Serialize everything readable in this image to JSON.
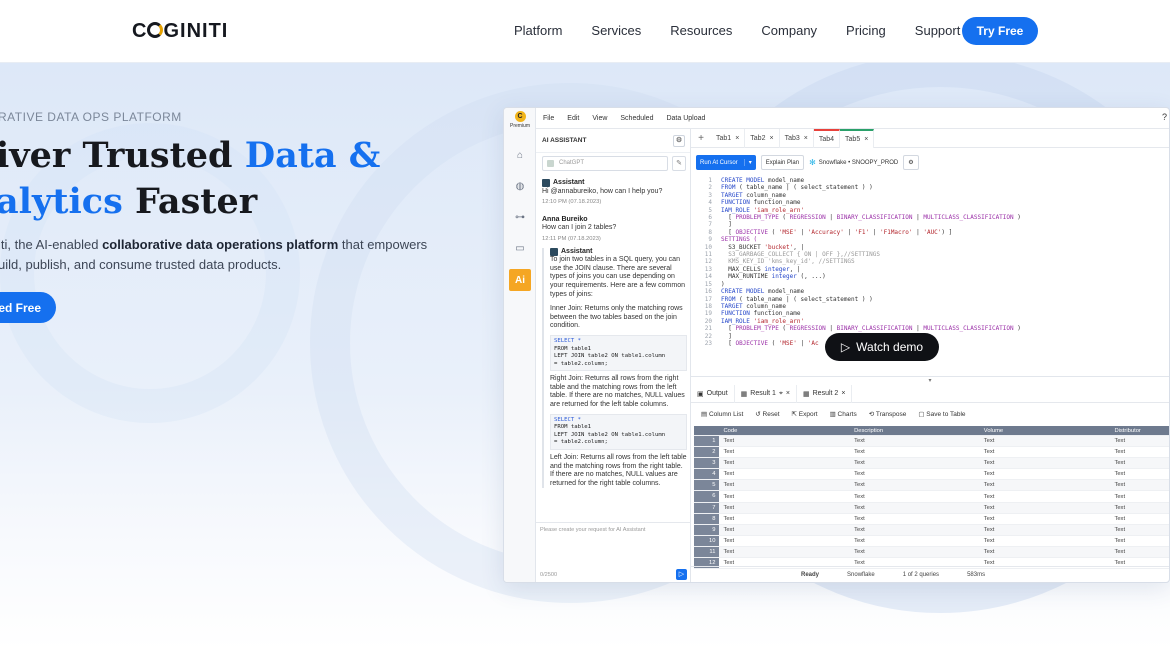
{
  "nav": {
    "logo": "COGINITI",
    "items": [
      "Platform",
      "Services",
      "Resources",
      "Company",
      "Pricing",
      "Support"
    ],
    "cta": "Try Free"
  },
  "hero": {
    "eyebrow": "RATIVE DATA OPS PLATFORM",
    "title_line1_a": "iver Trusted ",
    "title_line1_b": "Data &",
    "title_line2_a": "alytics",
    "title_line2_b": " Faster",
    "sub_a": "iti, the AI-enabled ",
    "sub_b": "collaborative data operations platform",
    "sub_c": " that empowers",
    "sub_line2": "uild, publish, and consume trusted data products.",
    "cta": "ed Free",
    "watch_demo": "Watch demo"
  },
  "app": {
    "premium": "Premium",
    "menubar": [
      "File",
      "Edit",
      "View",
      "Scheduled",
      "Data Upload"
    ],
    "help": "?",
    "ai": {
      "header": "AI ASSISTANT",
      "model": "ChatGPT",
      "assistant_name": "Assistant",
      "greeting": "Hi @annabureiko, how can I help you?",
      "ts1": "12:10 PM (07.18.2023)",
      "user_name": "Anna Bureiko",
      "question": "How can I join 2 tables?",
      "ts2": "12:11 PM (07.18.2023)",
      "answer_intro": "To join two tables in a SQL query, you can use the JOIN clause. There are several types of joins you can use depending on your requirements. Here are a few common types of joins:",
      "inner": "Inner Join: Returns only the matching rows between the two tables based on the join condition.",
      "code1_l1": "SELECT *",
      "code1_l2": "FROM table1",
      "code1_l3": "LEFT JOIN table2 ON table1.column",
      "code1_l4": "= table2.column;",
      "right": "Right Join: Returns all rows from the right table and the matching rows from the left table. If there are no matches, NULL values are returned for the left table columns.",
      "code2_l1": "SELECT *",
      "code2_l2": "FROM table1",
      "code2_l3": "LEFT JOIN table2 ON table1.column",
      "code2_l4": "= table2.column;",
      "left": "Left Join: Returns all rows from the left table and the matching rows from the right table. If there are no matches, NULL values are returned for the right table columns.",
      "placeholder": "Please create your request for AI Assistant",
      "counter": "0/2500"
    },
    "tabs": [
      "Tab1",
      "Tab2",
      "Tab3",
      "Tab4",
      "Tab5"
    ],
    "toolbar": {
      "run": "Run At Cursor",
      "explain": "Explain Plan",
      "connection": "Snowflake • SNOOPY_PROD"
    },
    "code_lines": [
      [
        {
          "t": "CREATE MODEL ",
          "c": "kw"
        },
        {
          "t": "model_name",
          "c": ""
        }
      ],
      [
        {
          "t": "FROM ",
          "c": "kw"
        },
        {
          "t": "( table_name | ( select_statement ) )",
          "c": ""
        }
      ],
      [
        {
          "t": "TARGET ",
          "c": "kw"
        },
        {
          "t": "column_name",
          "c": ""
        }
      ],
      [
        {
          "t": "FUNCTION ",
          "c": "kw"
        },
        {
          "t": "function_name",
          "c": ""
        }
      ],
      [
        {
          "t": "IAM_ROLE ",
          "c": "kw"
        },
        {
          "t": "'iam_role_arn'",
          "c": "st"
        }
      ],
      [
        {
          "t": "  [ ",
          "c": ""
        },
        {
          "t": "PROBLEM_TYPE",
          "c": "fn"
        },
        {
          "t": " ( ",
          "c": ""
        },
        {
          "t": "REGRESSION",
          "c": "fn"
        },
        {
          "t": " | ",
          "c": ""
        },
        {
          "t": "BINARY_CLASSIFICATION",
          "c": "fn"
        },
        {
          "t": " | ",
          "c": ""
        },
        {
          "t": "MULTICLASS_CLASSIFICATION",
          "c": "fn"
        },
        {
          "t": " )",
          "c": ""
        }
      ],
      [
        {
          "t": "  ]",
          "c": ""
        }
      ],
      [
        {
          "t": "  [ ",
          "c": ""
        },
        {
          "t": "OBJECTIVE",
          "c": "fn"
        },
        {
          "t": " ( ",
          "c": ""
        },
        {
          "t": "'MSE'",
          "c": "st"
        },
        {
          "t": " | ",
          "c": ""
        },
        {
          "t": "'Accuracy'",
          "c": "st"
        },
        {
          "t": " | ",
          "c": ""
        },
        {
          "t": "'F1'",
          "c": "st"
        },
        {
          "t": " | ",
          "c": ""
        },
        {
          "t": "'F1Macro'",
          "c": "st"
        },
        {
          "t": " | ",
          "c": ""
        },
        {
          "t": "'AUC'",
          "c": "st"
        },
        {
          "t": ") ]",
          "c": ""
        }
      ],
      [
        {
          "t": "SETTINGS (",
          "c": "fn"
        }
      ],
      [
        {
          "t": "  S3_BUCKET ",
          "c": ""
        },
        {
          "t": "'bucket'",
          "c": "st"
        },
        {
          "t": ", |",
          "c": ""
        }
      ],
      [
        {
          "t": "  S3_GARBAGE_COLLECT { ON | OFF },//SETTINGS",
          "c": "cm"
        }
      ],
      [
        {
          "t": "  KMS_KEY_ID 'kms_key_id', //SETTINGS",
          "c": "cm"
        }
      ],
      [
        {
          "t": "  MAX_CELLS ",
          "c": ""
        },
        {
          "t": "integer",
          "c": "kw"
        },
        {
          "t": ", |",
          "c": ""
        }
      ],
      [
        {
          "t": "  MAX_RUNTIME ",
          "c": ""
        },
        {
          "t": "integer",
          "c": "kw"
        },
        {
          "t": " (, ...)",
          "c": ""
        }
      ],
      [
        {
          "t": ")",
          "c": ""
        }
      ],
      [
        {
          "t": "CREATE MODEL ",
          "c": "kw"
        },
        {
          "t": "model_name",
          "c": ""
        }
      ],
      [
        {
          "t": "FROM ",
          "c": "kw"
        },
        {
          "t": "( table_name | ( select_statement ) )",
          "c": ""
        }
      ],
      [
        {
          "t": "TARGET ",
          "c": "kw"
        },
        {
          "t": "column_name",
          "c": ""
        }
      ],
      [
        {
          "t": "FUNCTION ",
          "c": "kw"
        },
        {
          "t": "function_name",
          "c": ""
        }
      ],
      [
        {
          "t": "IAM_ROLE ",
          "c": "kw"
        },
        {
          "t": "'iam_role_arn'",
          "c": "st"
        }
      ],
      [
        {
          "t": "  [ ",
          "c": ""
        },
        {
          "t": "PROBLEM_TYPE",
          "c": "fn"
        },
        {
          "t": " ( ",
          "c": ""
        },
        {
          "t": "REGRESSION",
          "c": "fn"
        },
        {
          "t": " | ",
          "c": ""
        },
        {
          "t": "BINARY_CLASSIFICATION",
          "c": "fn"
        },
        {
          "t": " | ",
          "c": ""
        },
        {
          "t": "MULTICLASS_CLASSIFICATION",
          "c": "fn"
        },
        {
          "t": " )",
          "c": ""
        }
      ],
      [
        {
          "t": "  ]",
          "c": ""
        }
      ],
      [
        {
          "t": "  [ ",
          "c": ""
        },
        {
          "t": "OBJECTIVE",
          "c": "fn"
        },
        {
          "t": " ( ",
          "c": ""
        },
        {
          "t": "'MSE'",
          "c": "st"
        },
        {
          "t": " | ",
          "c": ""
        },
        {
          "t": "'Ac",
          "c": "st"
        },
        {
          "t": "                  ",
          "c": ""
        },
        {
          "t": "'AUC'",
          "c": "st"
        },
        {
          "t": ") ]",
          "c": ""
        }
      ]
    ],
    "result_tabs": [
      "Output",
      "Result 1",
      "Result 2"
    ],
    "result_tools": [
      "Column List",
      "Reset",
      "Export",
      "Charts",
      "Transpose",
      "Save to Table"
    ],
    "grid_headers": [
      "Code",
      "Description",
      "Volume",
      "Distributor"
    ],
    "grid_cell": "Text",
    "grid_rows": 12,
    "status": [
      "Ready",
      "Snowflake",
      "1 of 2 queries",
      "583ms"
    ]
  }
}
